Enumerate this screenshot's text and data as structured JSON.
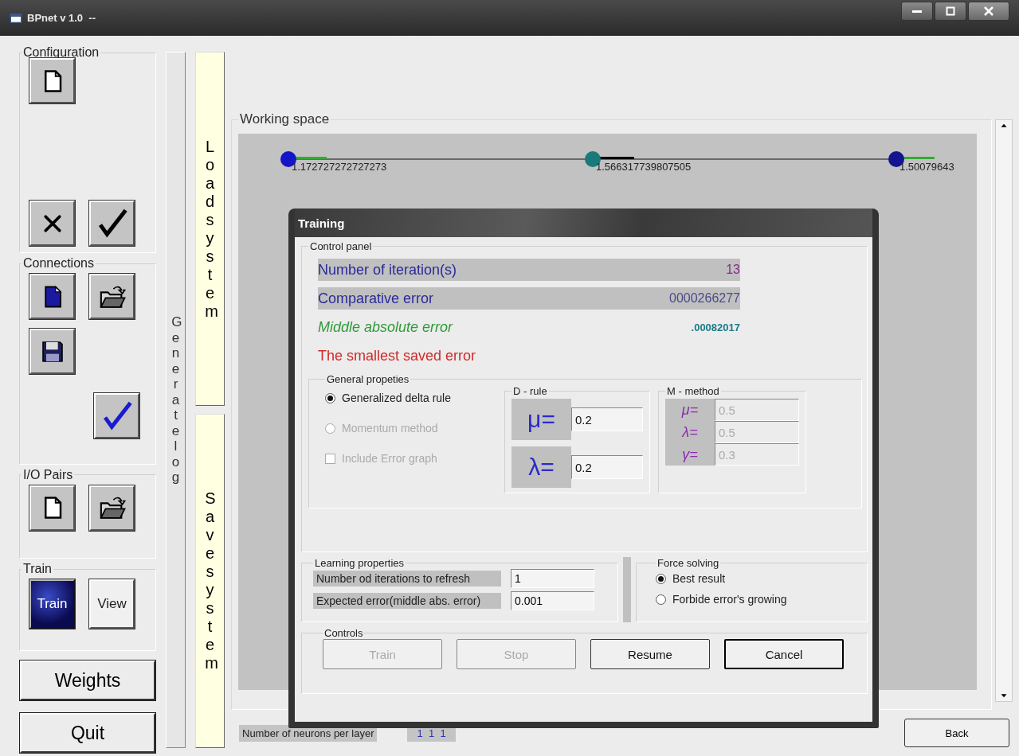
{
  "window": {
    "title": "BPnet v 1.0  --"
  },
  "sidebar": {
    "groups": [
      {
        "title": "Configuration",
        "rows": [
          [
            {
              "kind": "file"
            }
          ],
          [
            {
              "kind": "cross"
            },
            {
              "kind": "check"
            }
          ]
        ]
      },
      {
        "title": "Connections",
        "rows": [
          [
            {
              "kind": "file-blue"
            },
            {
              "kind": "folder"
            }
          ],
          [
            {
              "kind": "floppy"
            }
          ],
          [
            {
              "kind": "check-blue"
            }
          ]
        ]
      },
      {
        "title": "I/O Pairs",
        "rows": [
          [
            {
              "kind": "file"
            },
            {
              "kind": "folder"
            }
          ]
        ]
      },
      {
        "title": "Train",
        "rows": [
          [
            {
              "kind": "text",
              "label": "Train",
              "selected": true
            },
            {
              "kind": "text",
              "label": "View",
              "selected": false
            }
          ]
        ]
      }
    ],
    "weights_button": "Weights",
    "quit_button": "Quit"
  },
  "generate_log": "Generate log",
  "load_system": "Load system",
  "save_system": "Save system",
  "working_space": {
    "title": "Working space",
    "nodes": [
      {
        "label": "1.172727272727273",
        "color": "#1414c8"
      },
      {
        "label": "1.566317739807505",
        "color": "#1a7a7a"
      },
      {
        "label": "1.50079643",
        "color": "#141490"
      }
    ]
  },
  "footer": {
    "neurons_label": "Number of neurons per layer",
    "neurons_value": "1  1  1",
    "back_button": "Back"
  },
  "training_dialog": {
    "title": "Training",
    "control_panel": {
      "title": "Control panel",
      "rows": [
        {
          "kind": "bar",
          "label": "Number of iteration(s)",
          "value": "13",
          "color": "#2a2a9a"
        },
        {
          "kind": "bar",
          "label": "Comparative error",
          "value": "0000266277",
          "color": "#2a2a9a"
        },
        {
          "kind": "italic",
          "label": "Middle absolute error",
          "value": ".00082017",
          "color": "#2f9a3a"
        },
        {
          "kind": "plain",
          "label": "The smallest saved error",
          "color": "#d02a2a"
        }
      ]
    },
    "general": {
      "title": "General propeties",
      "options": [
        {
          "kind": "radio",
          "label": "Generalized delta rule",
          "checked": true,
          "disabled": false
        },
        {
          "kind": "radio",
          "label": "Momentum method",
          "checked": false,
          "disabled": true
        },
        {
          "kind": "checkbox",
          "label": "Include Error graph",
          "checked": false,
          "disabled": true
        }
      ],
      "d_rule": {
        "title": "D - rule",
        "disabled": false,
        "params": [
          {
            "symbol": "μ=",
            "value": "0.2"
          },
          {
            "symbol": "λ=",
            "value": "0.2"
          }
        ]
      },
      "m_method": {
        "title": "M - method",
        "disabled": true,
        "params": [
          {
            "symbol": "μ=",
            "value": "0.5"
          },
          {
            "symbol": "λ=",
            "value": "0.5"
          },
          {
            "symbol": "γ=",
            "value": "0.3"
          }
        ]
      }
    },
    "learning": {
      "title": "Learning properties",
      "fields": [
        {
          "label": "Number od iterations to refresh",
          "value": "1"
        },
        {
          "label": "Expected error(middle abs. error)",
          "value": "0.001"
        }
      ]
    },
    "force_solving": {
      "title": "Force solving",
      "options": [
        {
          "label": "Best result",
          "selected": true
        },
        {
          "label": "Forbide error's growing",
          "selected": false
        }
      ]
    },
    "controls": {
      "title": "Controls",
      "buttons": [
        {
          "label": "Train",
          "disabled": true,
          "default": false
        },
        {
          "label": "Stop",
          "disabled": true,
          "default": false
        },
        {
          "label": "Resume",
          "disabled": false,
          "default": false
        },
        {
          "label": "Cancel",
          "disabled": false,
          "default": true
        }
      ]
    }
  }
}
